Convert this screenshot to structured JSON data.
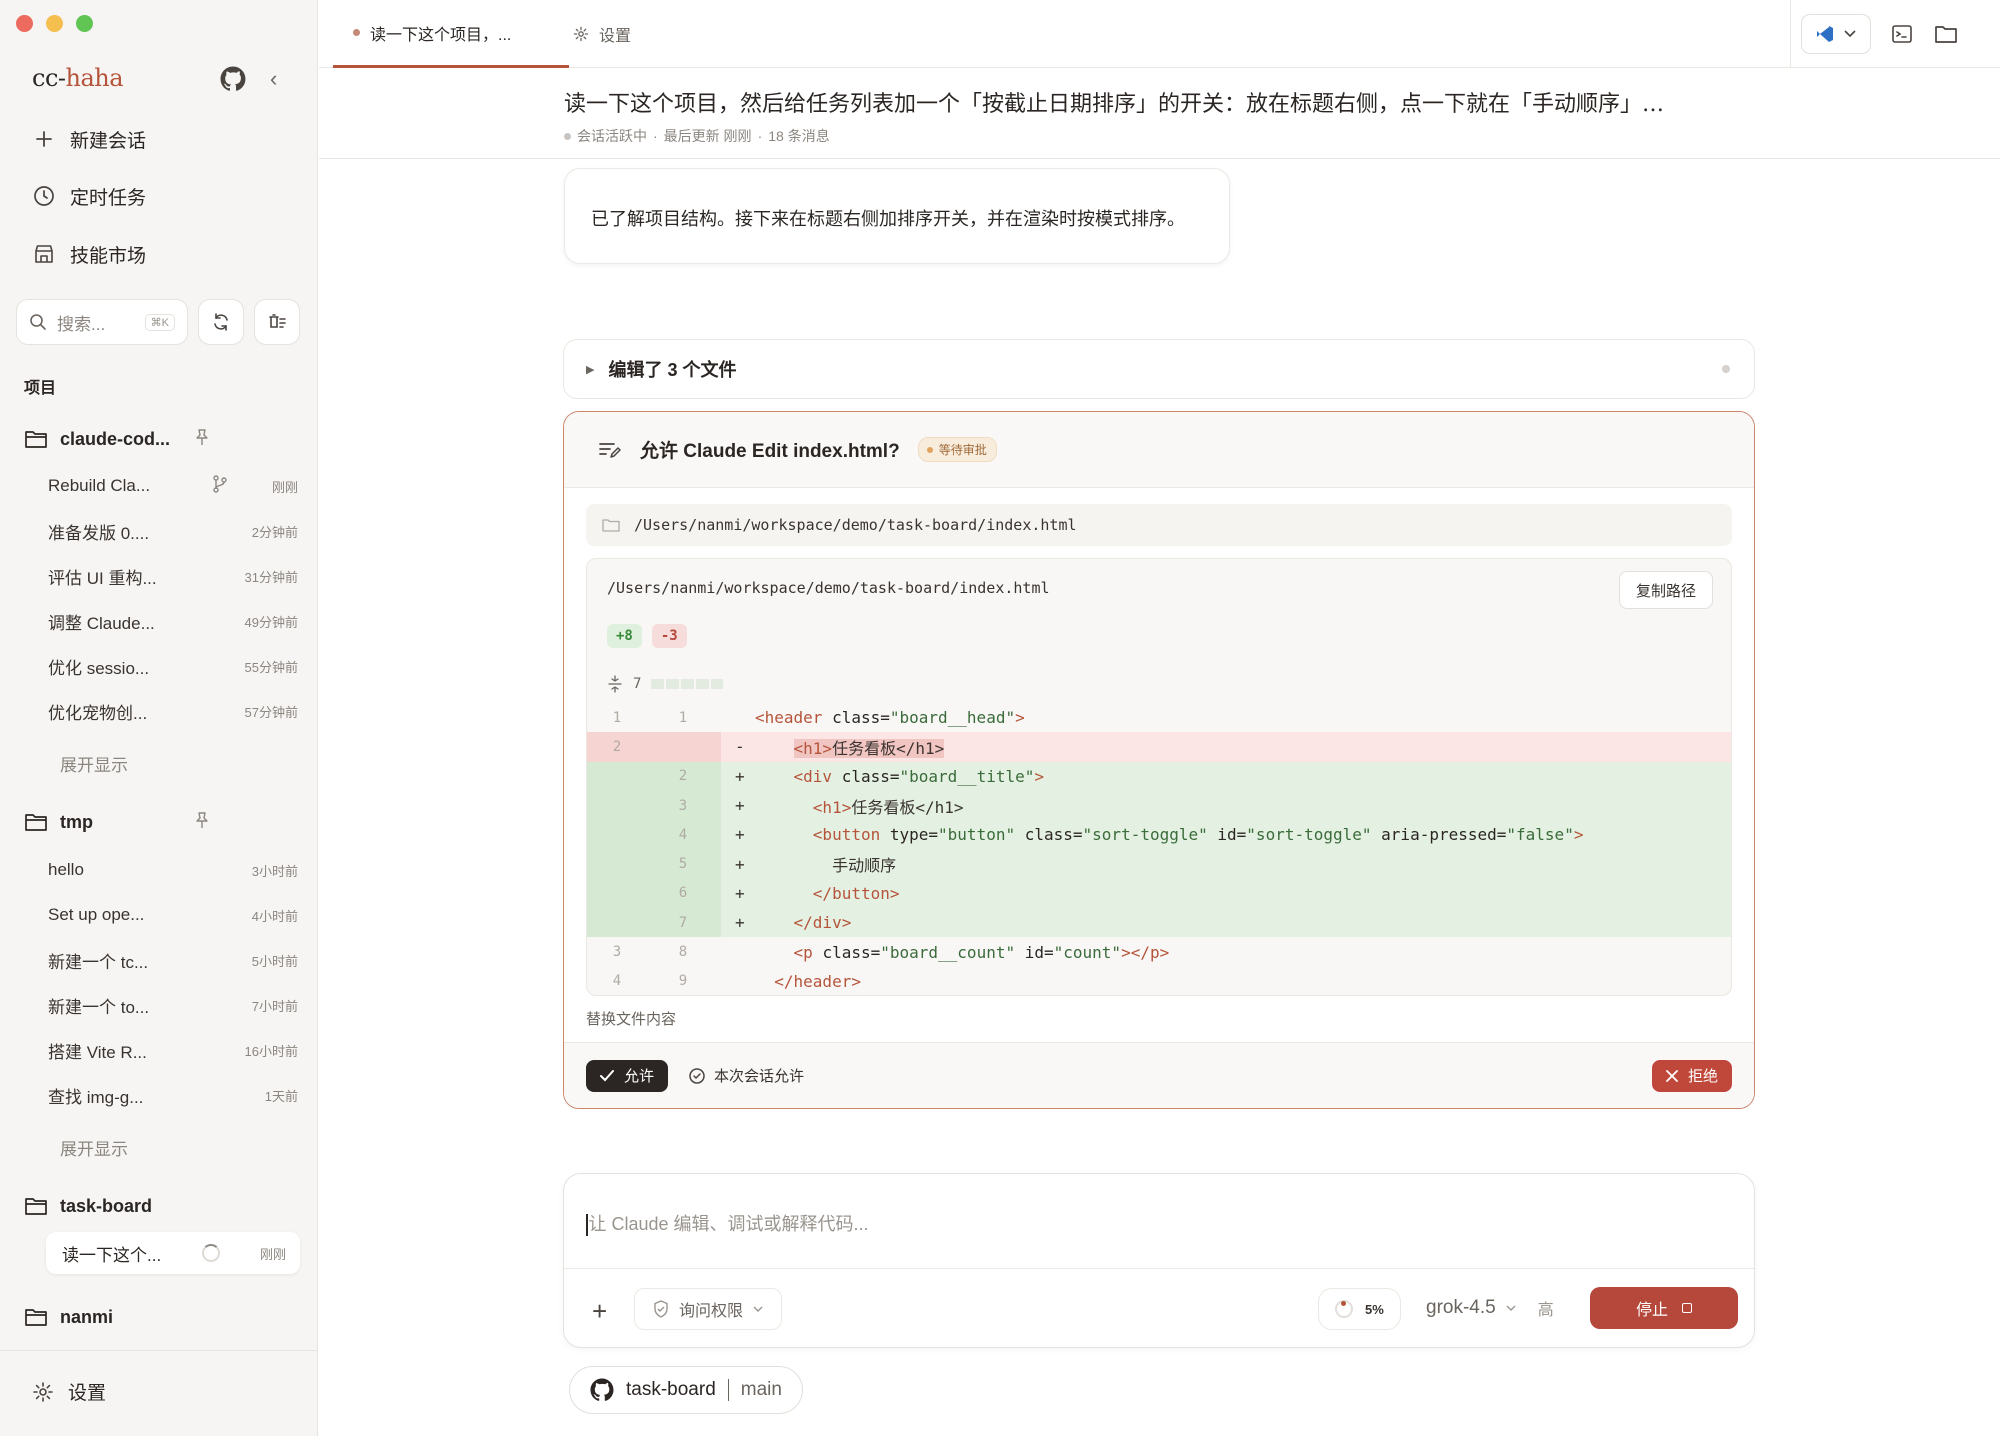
{
  "sidebar": {
    "brand_prefix": "cc-",
    "brand_suffix": "haha",
    "nav": [
      {
        "label": "新建会话",
        "icon": "plus-icon"
      },
      {
        "label": "定时任务",
        "icon": "clock-icon"
      },
      {
        "label": "技能市场",
        "icon": "store-icon"
      }
    ],
    "search": {
      "placeholder": "搜索...",
      "shortcut": "⌘K"
    },
    "section_label": "项目",
    "projects": [
      {
        "name": "claude-cod...",
        "sessions": [
          {
            "title": "Rebuild Cla...",
            "time": "刚刚"
          },
          {
            "title": "准备发版 0....",
            "time": "2分钟前"
          },
          {
            "title": "评估 UI 重构...",
            "time": "31分钟前"
          },
          {
            "title": "调整 Claude...",
            "time": "49分钟前"
          },
          {
            "title": "优化 sessio...",
            "time": "55分钟前"
          },
          {
            "title": "优化宠物创...",
            "time": "57分钟前"
          }
        ],
        "more": "展开显示"
      },
      {
        "name": "tmp",
        "sessions": [
          {
            "title": "hello",
            "time": "3小时前"
          },
          {
            "title": "Set up ope...",
            "time": "4小时前"
          },
          {
            "title": "新建一个 tc...",
            "time": "5小时前"
          },
          {
            "title": "新建一个 to...",
            "time": "7小时前"
          },
          {
            "title": "搭建 Vite R...",
            "time": "16小时前"
          },
          {
            "title": "查找 img-g...",
            "time": "1天前"
          }
        ],
        "more": "展开显示"
      },
      {
        "name": "task-board",
        "sessions": [
          {
            "title": "读一下这个...",
            "time": "刚刚"
          }
        ]
      },
      {
        "name": "nanmi"
      }
    ],
    "settings_label": "设置"
  },
  "topbar": {
    "tabs": [
      {
        "label": "读一下这个项目，...",
        "active": true
      },
      {
        "label": "设置",
        "active": false
      }
    ]
  },
  "conversation": {
    "title": "读一下这个项目，然后给任务列表加一个「按截止日期排序」的开关：放在标题右侧，点一下就在「手动顺序」…",
    "status": "会话活跃中",
    "updated": "最后更新 刚刚",
    "messages_count": "18 条消息",
    "sep": "·",
    "assistant_message": "已了解项目结构。接下来在标题右侧加排序开关，并在渲染时按模式排序。",
    "edited_summary": "编辑了 3 个文件"
  },
  "permission": {
    "title": "允许 Claude Edit index.html?",
    "status_badge": "等待审批",
    "path": "/Users/nanmi/workspace/demo/task-board/index.html",
    "diff_path": "/Users/nanmi/workspace/demo/task-board/index.html",
    "copy_label": "复制路径",
    "additions": "+8",
    "deletions": "-3",
    "hunk_label": "7",
    "note": "替换文件内容",
    "allow_label": "允许",
    "session_allow_label": "本次会话允许",
    "reject_label": "拒绝"
  },
  "diff_lines": [
    {
      "type": "ctx",
      "old": "1",
      "new": "1",
      "sign": "",
      "indent": "",
      "tag": "<header ",
      "attrs": [
        {
          "k": "class=",
          "v": "\"board__head\""
        }
      ],
      "after": ">"
    },
    {
      "type": "del",
      "old": "2",
      "new": "",
      "sign": "-",
      "indent": "    ",
      "tag": "<h1>",
      "attrs": [],
      "after": "任务看板</h1>"
    },
    {
      "type": "add",
      "old": "",
      "new": "2",
      "sign": "+",
      "indent": "    ",
      "tag": "<div ",
      "attrs": [
        {
          "k": "class=",
          "v": "\"board__title\""
        }
      ],
      "after": ">"
    },
    {
      "type": "add",
      "old": "",
      "new": "3",
      "sign": "+",
      "indent": "      ",
      "tag": "<h1>",
      "attrs": [],
      "after": "任务看板</h1>"
    },
    {
      "type": "add",
      "old": "",
      "new": "4",
      "sign": "+",
      "indent": "      ",
      "tag": "<button ",
      "attrs": [
        {
          "k": "type=",
          "v": "\"button\""
        },
        {
          "k": " class=",
          "v": "\"sort-toggle\""
        },
        {
          "k": " id=",
          "v": "\"sort-toggle\""
        },
        {
          "k": " aria-pressed=",
          "v": "\"false\""
        }
      ],
      "after": ">"
    },
    {
      "type": "add",
      "old": "",
      "new": "5",
      "sign": "+",
      "indent": "        ",
      "tag": "",
      "attrs": [],
      "after": "手动顺序"
    },
    {
      "type": "add",
      "old": "",
      "new": "6",
      "sign": "+",
      "indent": "      ",
      "tag": "</button>",
      "attrs": [],
      "after": ""
    },
    {
      "type": "add",
      "old": "",
      "new": "7",
      "sign": "+",
      "indent": "    ",
      "tag": "</div>",
      "attrs": [],
      "after": ""
    },
    {
      "type": "ctx",
      "old": "3",
      "new": "8",
      "sign": "",
      "indent": "    ",
      "tag": "<p ",
      "attrs": [
        {
          "k": "class=",
          "v": "\"board__count\""
        },
        {
          "k": " id=",
          "v": "\"count\""
        }
      ],
      "after": "></p>"
    },
    {
      "type": "ctx",
      "old": "4",
      "new": "9",
      "sign": "",
      "indent": "  ",
      "tag": "</header>",
      "attrs": [],
      "after": ""
    }
  ],
  "composer": {
    "placeholder": "让 Claude 编辑、调试或解释代码...",
    "permission_mode": "询问权限",
    "context_usage": "5%",
    "model": "grok-4.5",
    "effort": "高",
    "stop_label": "停止"
  },
  "repo_chip": {
    "repo": "task-board",
    "branch": "main"
  },
  "colors": {
    "accent": "#b5543a",
    "stop": "#b5473b",
    "border_perm": "#c8876d"
  }
}
